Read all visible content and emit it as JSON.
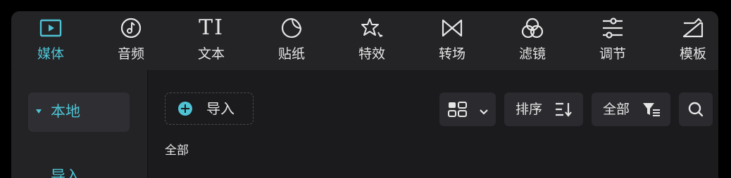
{
  "toolbar": {
    "items": [
      {
        "label": "媒体",
        "icon": "media-play-icon",
        "active": true
      },
      {
        "label": "音频",
        "icon": "audio-note-icon",
        "active": false
      },
      {
        "label": "文本",
        "icon": "text-ti-icon",
        "active": false
      },
      {
        "label": "贴纸",
        "icon": "sticker-icon",
        "active": false
      },
      {
        "label": "特效",
        "icon": "effects-star-icon",
        "active": false
      },
      {
        "label": "转场",
        "icon": "transition-bowtie-icon",
        "active": false
      },
      {
        "label": "滤镜",
        "icon": "filter-circles-icon",
        "active": false
      },
      {
        "label": "调节",
        "icon": "adjust-sliders-icon",
        "active": false
      },
      {
        "label": "模板",
        "icon": "template-icon",
        "active": false
      }
    ],
    "text_icon_glyph": "TI"
  },
  "sidebar": {
    "local_label": "本地",
    "import_label": "导入"
  },
  "content": {
    "import_button_label": "导入",
    "sort_label": "排序",
    "filter_label": "全部",
    "section_label": "全部"
  },
  "colors": {
    "accent": "#4fc3d3",
    "toolbar_bg": "#242427",
    "panel_bg": "#1b1b1e",
    "control_bg": "#2b2b2f",
    "text": "#e6e6e6"
  }
}
